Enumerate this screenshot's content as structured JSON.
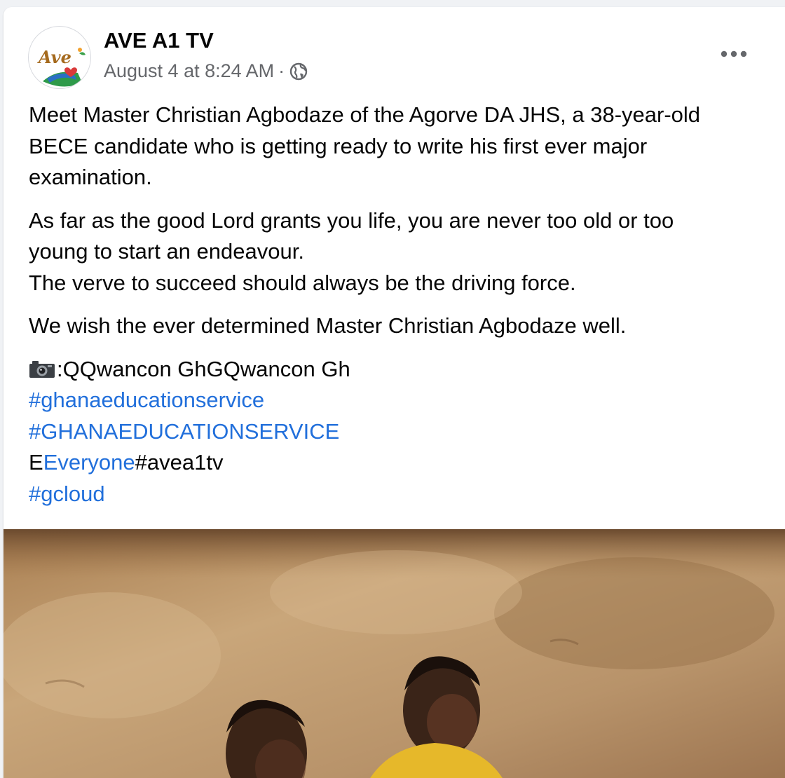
{
  "post": {
    "author": "AVE A1 TV",
    "avatar_text": "Ave",
    "timestamp": "August 4 at 8:24 AM",
    "separator": "·",
    "audience_icon": "globe-icon",
    "more_icon": "more-options-icon",
    "paragraphs": {
      "p1": [
        "Meet Master Christian Agbodaze of the Agorve DA JHS, a 38-year-old",
        "BECE candidate who is getting ready to write his first ever major",
        "examination."
      ],
      "p2": [
        "As far as the good Lord grants you life, you are never too old or too",
        "young to start an endeavour.",
        "The verve to succeed should always be the driving force."
      ],
      "p3": "We wish the ever determined Master Christian Agbodaze well."
    },
    "credit": {
      "icon": "camera-icon",
      "text": ":QQwancon GhGQwancon Gh"
    },
    "hashtags": {
      "tag1": "#ghanaeducationservice",
      "tag2": "#GHANAEDUCATIONSERVICE",
      "everyone_prefix": "E",
      "everyone_link": "Everyone",
      "tag3": "#avea1tv",
      "tag4": "#gcloud"
    },
    "colors": {
      "link": "#216fdb",
      "text": "#050505",
      "meta": "#65676b"
    }
  }
}
